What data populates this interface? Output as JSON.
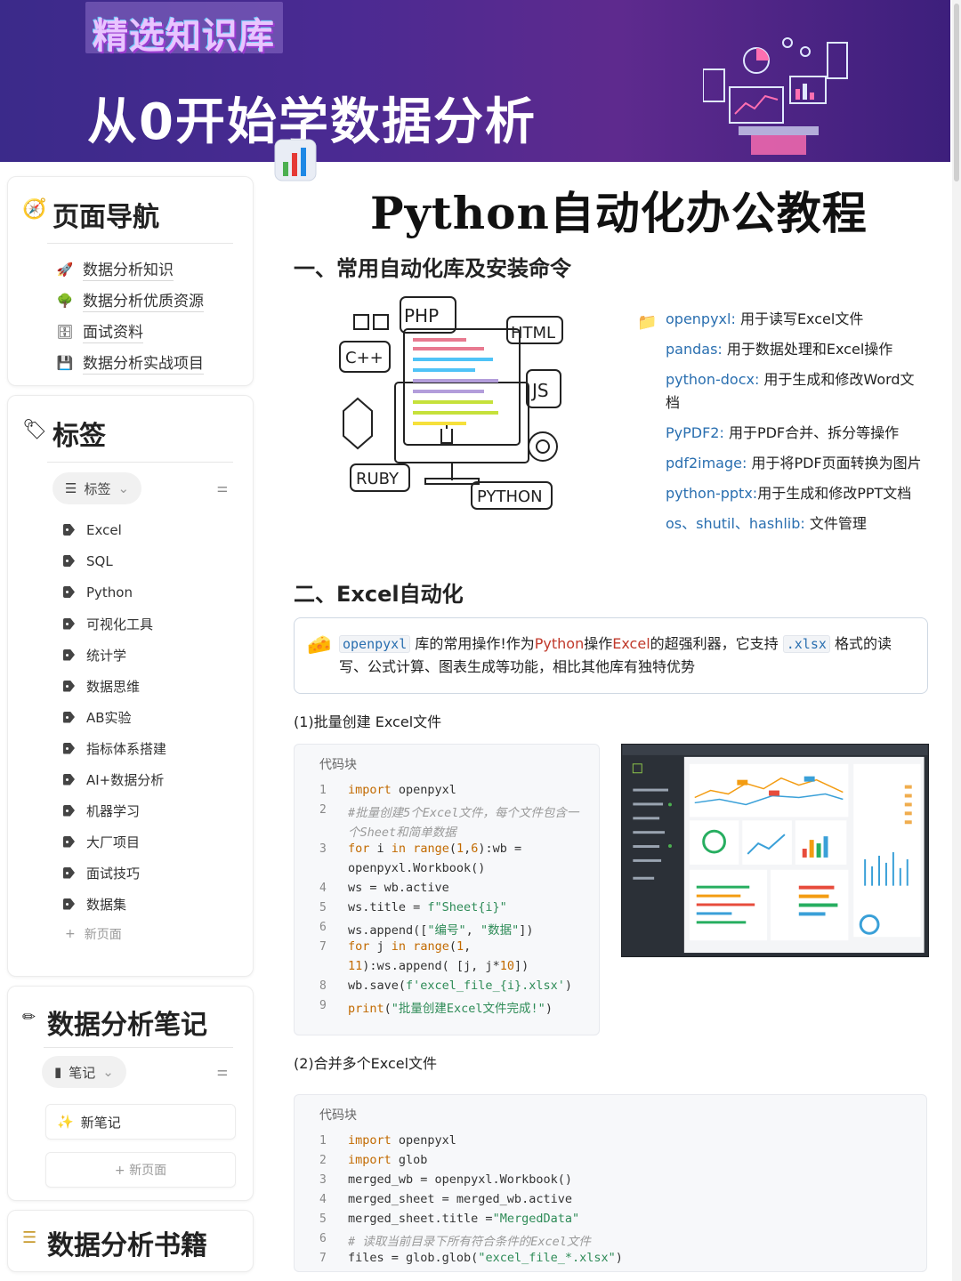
{
  "banner": {
    "badge": "精选知识库",
    "title": "从0开始学数据分析"
  },
  "page_title": "Python自动化办公教程",
  "sidebar": {
    "nav": {
      "title": "页面导航",
      "items": [
        {
          "icon": "rocket-icon",
          "label": "数据分析知识"
        },
        {
          "icon": "tree-icon",
          "label": "数据分析优质资源"
        },
        {
          "icon": "cabinet-icon",
          "label": "面试资料"
        },
        {
          "icon": "floppy-icon",
          "label": "数据分析实战项目"
        }
      ]
    },
    "tags": {
      "title": "标签",
      "filter_label": "标签",
      "items": [
        "Excel",
        "SQL",
        "Python",
        "可视化工具",
        "统计学",
        "数据思维",
        "AB实验",
        "指标体系搭建",
        "AI+数据分析",
        "机器学习",
        "大厂项目",
        "面试技巧",
        "数据集"
      ],
      "new_page": "新页面"
    },
    "notes": {
      "title": "数据分析笔记",
      "filter_label": "笔记",
      "new_note": "新笔记",
      "new_page": "+ 新页面"
    },
    "books": {
      "title": "数据分析书籍"
    }
  },
  "section1": {
    "heading": "一、常用自动化库及安装命令",
    "illustration_labels": [
      "PHP",
      "HTML",
      "C++",
      "JS",
      "RUBY",
      "PYTHON"
    ],
    "libs": [
      {
        "name": "openpyxl:",
        "desc": " 用于读写Excel文件"
      },
      {
        "name": "pandas:",
        "desc": " 用于数据处理和Excel操作"
      },
      {
        "name": "python-docx:",
        "desc": " 用于生成和修改Word文档"
      },
      {
        "name": "PyPDF2:",
        "desc": " 用于PDF合并、拆分等操作"
      },
      {
        "name": "pdf2image:",
        "desc": " 用于将PDF页面转换为图片"
      },
      {
        "name": "python-pptx:",
        "desc": "用于生成和修改PPT文档"
      },
      {
        "name": "os、shutil、hashlib:",
        "desc": " 文件管理"
      }
    ]
  },
  "section2": {
    "heading": "二、Excel自动化",
    "callout": {
      "code": "openpyxl",
      "t1": "库的常用操作!作为",
      "python": "Python",
      "t2": "操作",
      "excel": "Excel",
      "t3": "的超强利器，它支持",
      "ext": ".xlsx",
      "t4": "格式的读写、公式计算、图表生成等功能，相比其他库有独特优势"
    },
    "sub1": "(1)批量创建 Excel文件",
    "sub2": "(2)合并多个Excel文件",
    "code_label": "代码块"
  },
  "colors": {
    "banner_start": "#3b2a8a",
    "banner_end": "#5e2a8e",
    "link_blue": "#2a6fb0",
    "keyword_orange": "#c26a00",
    "string_green": "#2e8b57"
  }
}
